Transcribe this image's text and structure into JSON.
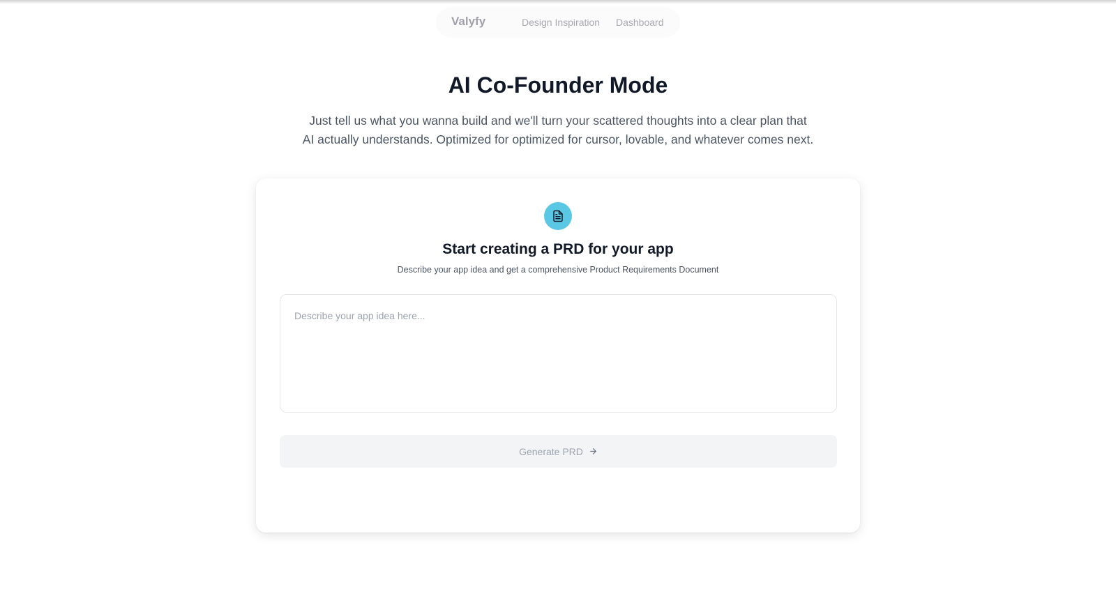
{
  "nav": {
    "brand": "Valyfy",
    "links": [
      {
        "label": "Design Inspiration"
      },
      {
        "label": "Dashboard"
      }
    ]
  },
  "hero": {
    "title": "AI Co-Founder Mode",
    "subtitle_line1": "Just tell us what you wanna build and we'll turn your scattered thoughts into a clear plan that",
    "subtitle_line2": "AI actually understands. Optimized for optimized for cursor, lovable, and whatever comes next."
  },
  "card": {
    "icon": "document-icon",
    "accent_color": "#5ac8e4",
    "title": "Start creating a PRD for your app",
    "subtitle": "Describe your app idea and get a comprehensive Product Requirements Document",
    "input": {
      "value": "",
      "placeholder": "Describe your app idea here..."
    },
    "generate_button": {
      "label": "Generate PRD",
      "icon": "arrow-right-icon",
      "disabled": true
    }
  }
}
